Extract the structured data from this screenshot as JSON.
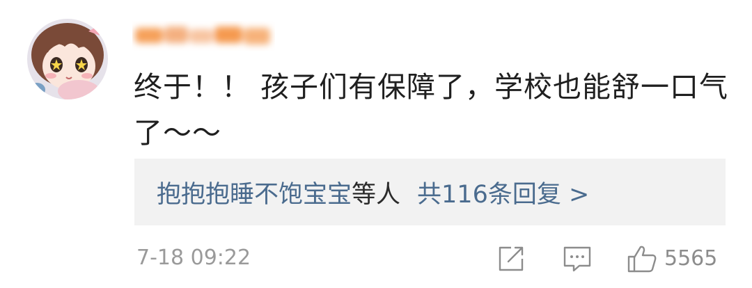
{
  "comment": {
    "text": "终于！！ 孩子们有保障了，学校也能舒一口气了～～",
    "replies": {
      "users": "抱抱抱睡不饱宝宝",
      "suffix": "等人",
      "count_text": "共116条回复 >"
    },
    "time": "7-18 09:22",
    "likes": "5565"
  },
  "icons": {
    "share": "share-icon",
    "reply": "comment-icon",
    "like": "thumbs-up-icon"
  },
  "colors": {
    "link": "#4a6b8e",
    "text": "#1f1f1f",
    "meta": "#9a9a9a",
    "reply_bg": "#f2f2f2"
  }
}
